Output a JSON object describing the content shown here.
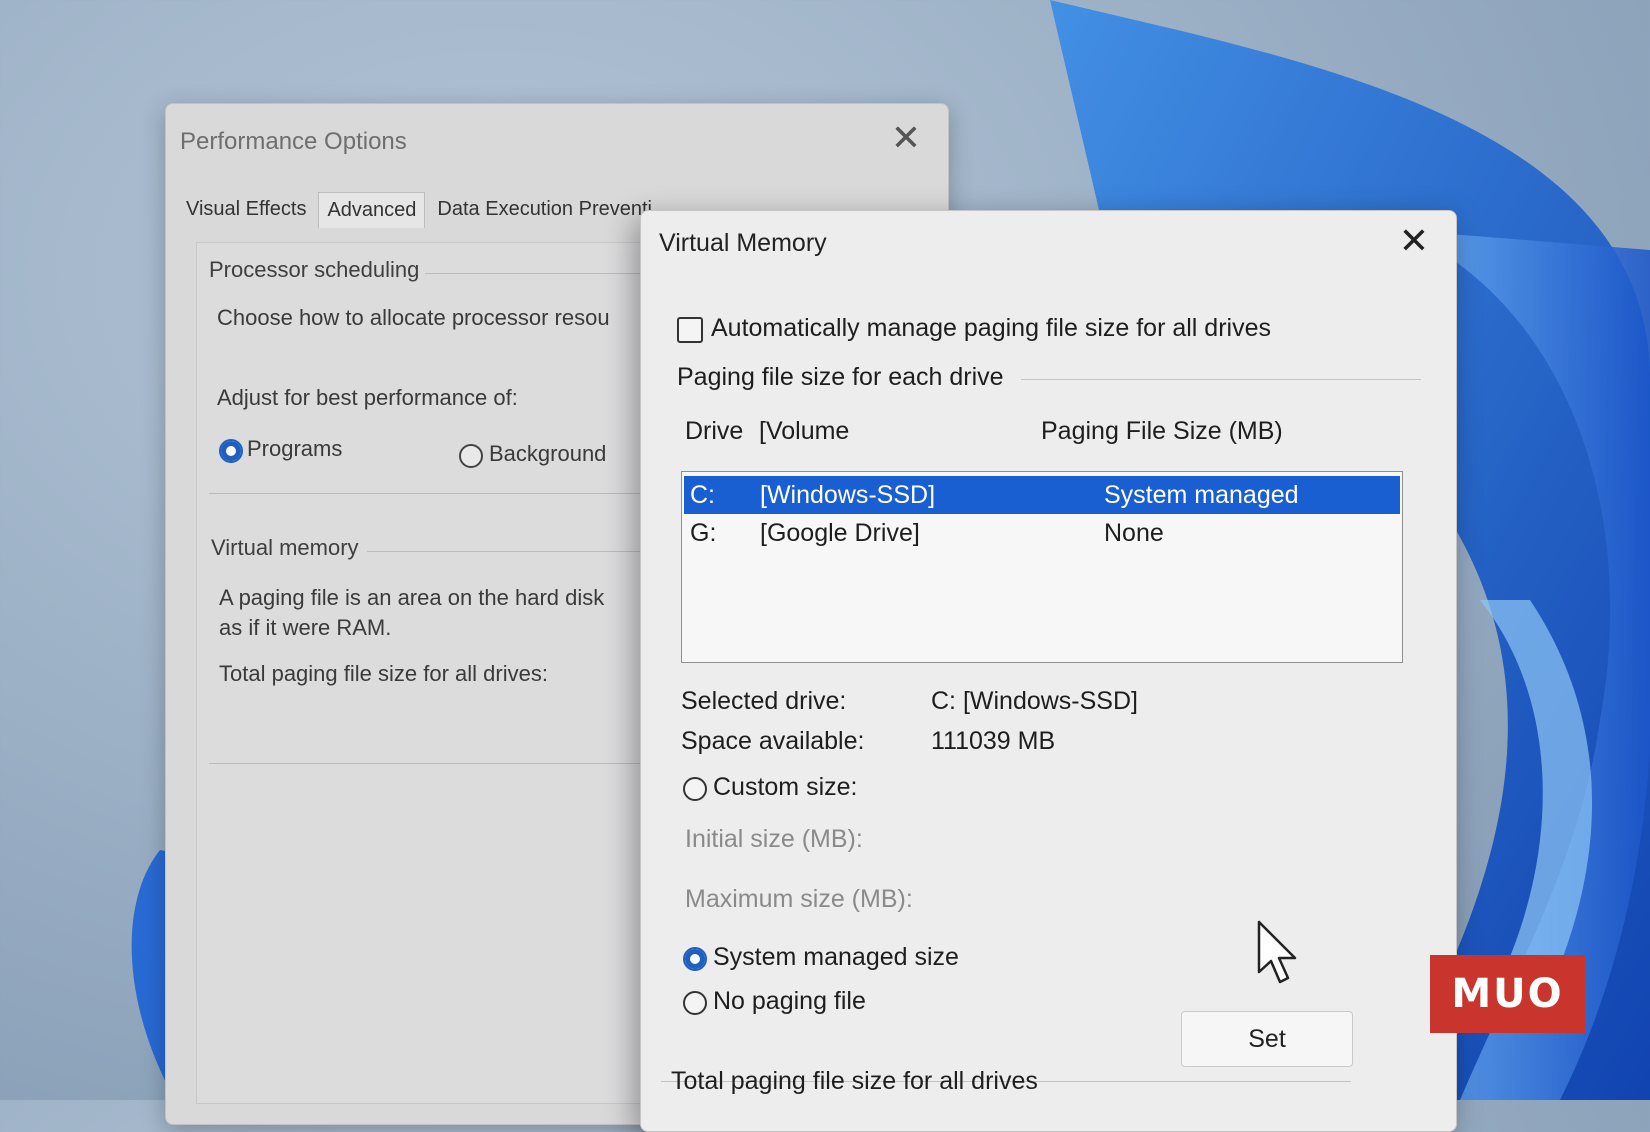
{
  "performance_options": {
    "title": "Performance Options",
    "tabs": [
      "Visual Effects",
      "Advanced",
      "Data Execution Preventi"
    ],
    "processor_scheduling": {
      "heading": "Processor scheduling",
      "description": "Choose how to allocate processor resou",
      "adjust_label": "Adjust for best performance of:",
      "programs_label": "Programs",
      "background_label": "Background"
    },
    "virtual_memory": {
      "heading": "Virtual memory",
      "description_line1": "A paging file is an area on the hard disk",
      "description_line2": "as if it were RAM.",
      "total_label": "Total paging file size for all drives:"
    }
  },
  "virtual_memory_dialog": {
    "title": "Virtual Memory",
    "auto_manage_label": "Automatically manage paging file size for all drives",
    "auto_manage_checked": false,
    "group_heading": "Paging file size for each drive",
    "columns": {
      "drive": "Drive",
      "volume": "[Volume",
      "size": "Paging File Size (MB)"
    },
    "drives": [
      {
        "drive": "C:",
        "volume": "[Windows-SSD]",
        "size": "System managed",
        "selected": true
      },
      {
        "drive": "G:",
        "volume": "[Google Drive]",
        "size": "None",
        "selected": false
      }
    ],
    "selected_drive_label": "Selected drive:",
    "selected_drive_value": "C:  [Windows-SSD]",
    "space_available_label": "Space available:",
    "space_available_value": "111039 MB",
    "custom_size_label": "Custom size:",
    "initial_size_label": "Initial size (MB):",
    "maximum_size_label": "Maximum size (MB):",
    "system_managed_label": "System managed size",
    "no_paging_label": "No paging file",
    "set_label": "Set",
    "total_label": "Total paging file size for all drives"
  },
  "watermark": "MUO",
  "colors": {
    "selection": "#1a5fd1",
    "watermark_bg": "#c9352c",
    "radio_selected": "#1f5fbf"
  }
}
